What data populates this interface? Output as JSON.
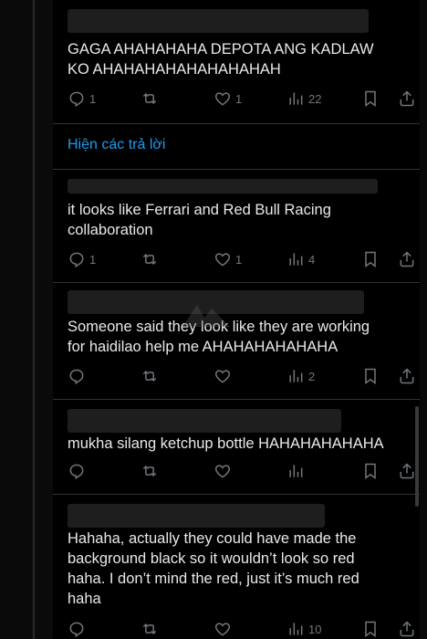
{
  "tweets": [
    {
      "text": "GAGA AHAHAHAHA DEPOTA ANG KADLAW\nKO AHAHAHAHAHAHAHAHAH",
      "reply_count": "1",
      "retweet_count": "",
      "like_count": "1",
      "view_count": "22"
    },
    {
      "text": "it looks like Ferrari and Red Bull Racing\ncollaboration",
      "reply_count": "1",
      "retweet_count": "",
      "like_count": "1",
      "view_count": "4"
    },
    {
      "text": "Someone said they look like they are working\nfor haidilao help me AHAHAHAHAHAHA",
      "reply_count": "",
      "retweet_count": "",
      "like_count": "",
      "view_count": "2"
    },
    {
      "text": "mukha silang ketchup bottle HAHAHAHAHAHA",
      "reply_count": "",
      "retweet_count": "",
      "like_count": "",
      "view_count": ""
    },
    {
      "text": "Hahaha, actually they could have made the\nbackground black so it wouldn’t look so red\nhaha. I don’t mind the red, just it’s much red\nhaha",
      "reply_count": "",
      "retweet_count": "",
      "like_count": "",
      "view_count": "10"
    }
  ],
  "show_replies_label": "Hiện các trả lời",
  "icons": {
    "reply": "reply-icon",
    "retweet": "retweet-icon",
    "like": "heart-icon",
    "views": "views-icon",
    "bookmark": "bookmark-icon",
    "share": "share-icon"
  },
  "colors": {
    "background": "#000000",
    "text": "#e7e9ea",
    "muted": "#71767b",
    "link": "#1d9bf0",
    "divider": "#2f3336"
  }
}
